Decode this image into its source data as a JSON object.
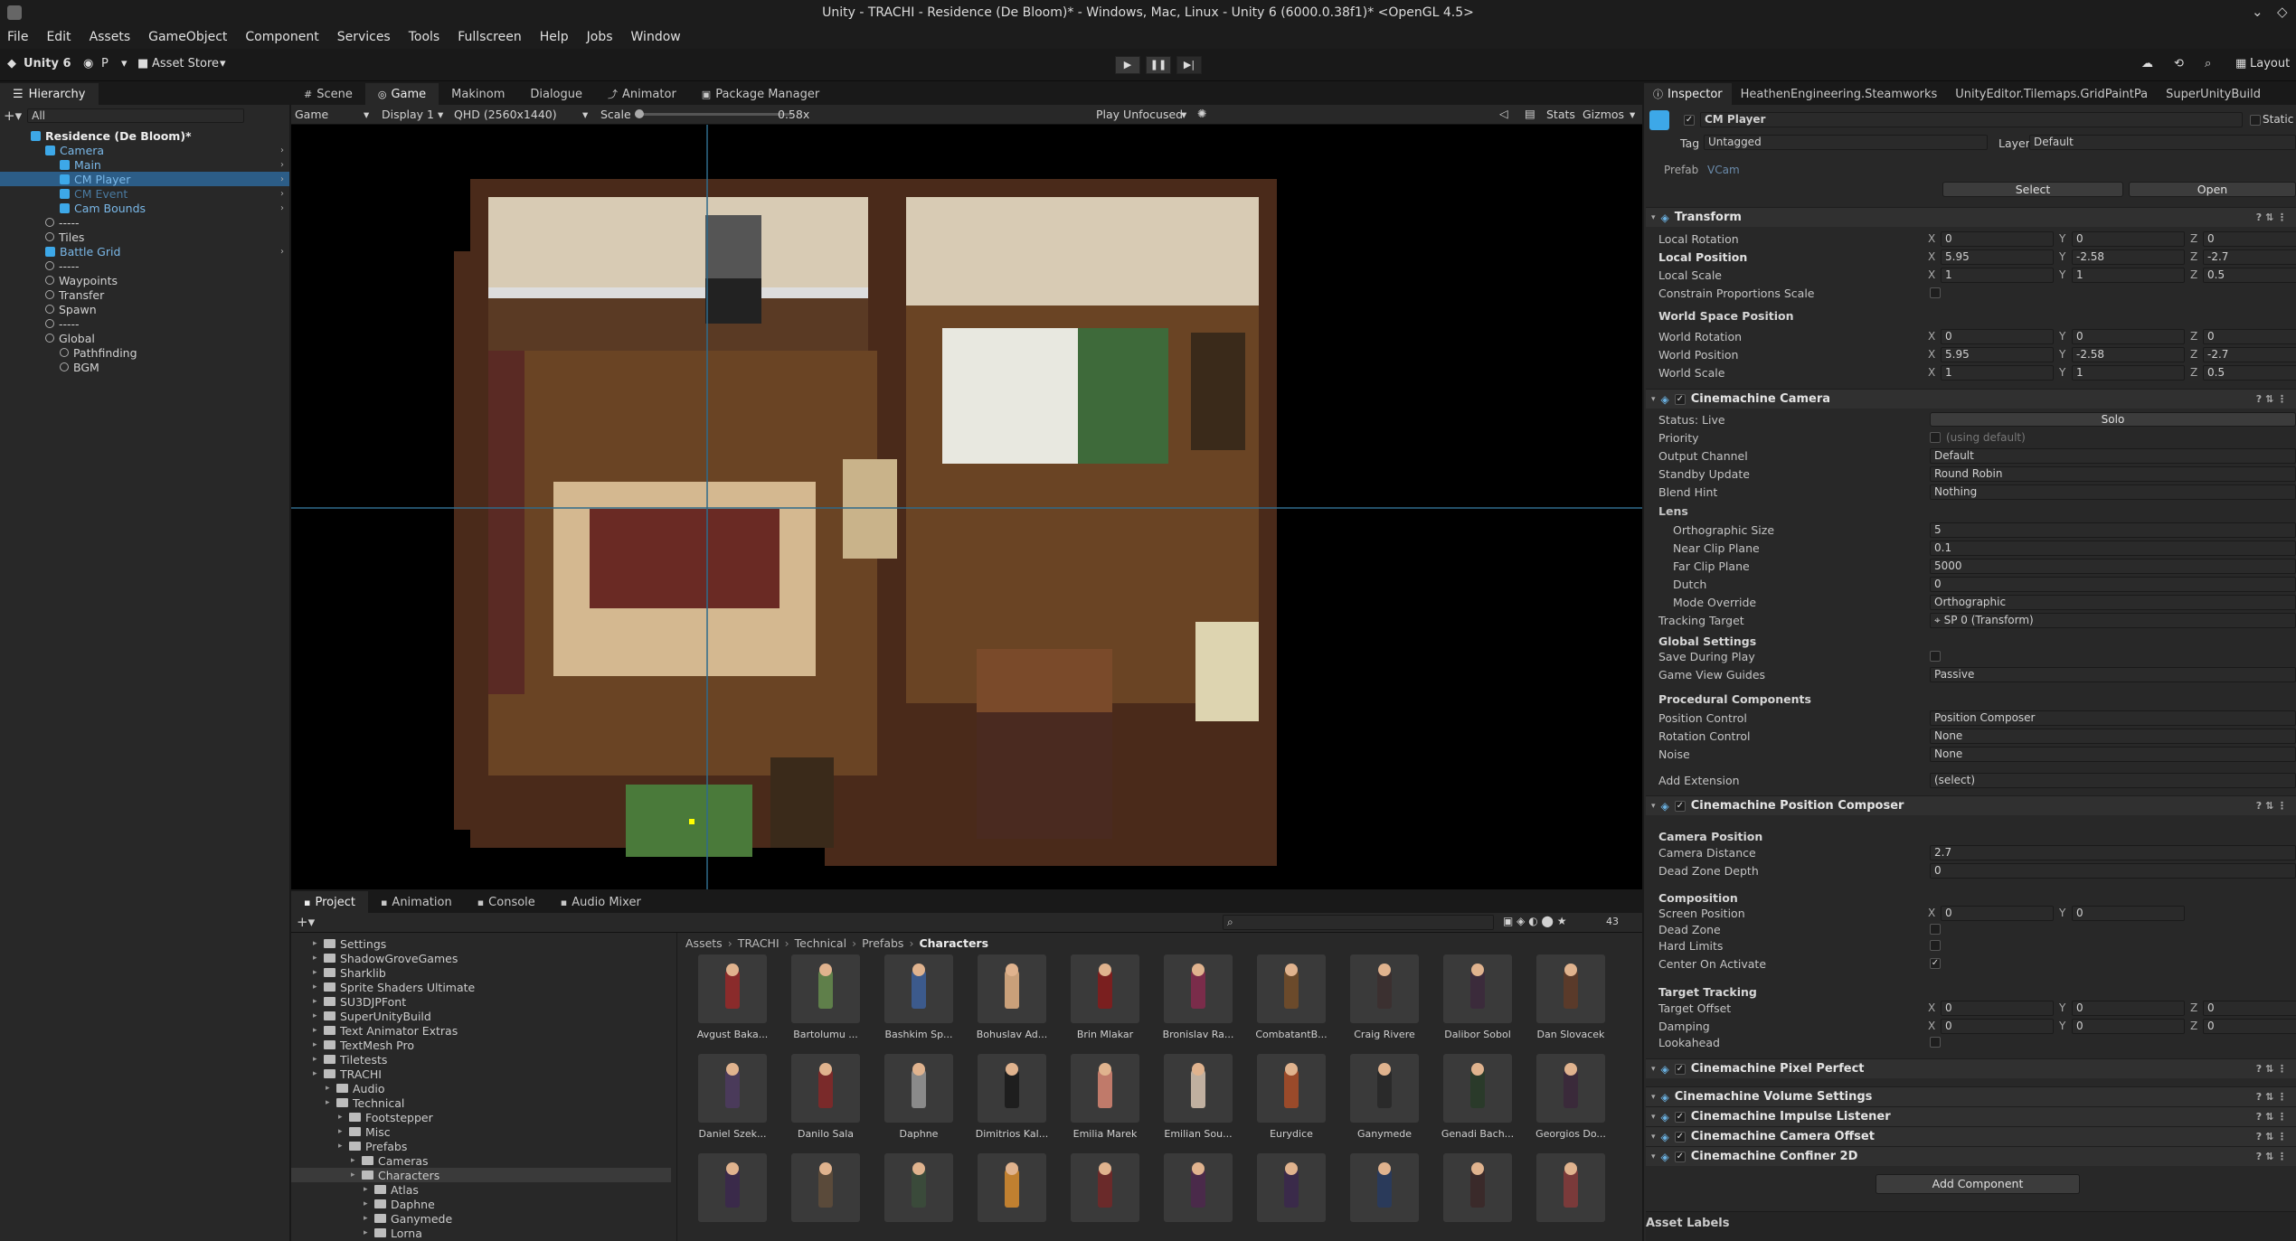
{
  "window": {
    "title": "Unity - TRACHI - Residence (De Bloom)* - Windows, Mac, Linux - Unity 6 (6000.0.38f1)* <OpenGL 4.5>"
  },
  "menu": [
    "File",
    "Edit",
    "Assets",
    "GameObject",
    "Component",
    "Services",
    "Tools",
    "Fullscreen",
    "Help",
    "Jobs",
    "Window"
  ],
  "toolbar": {
    "account": "Unity 6",
    "user": "P",
    "asset_store": "Asset Store",
    "layout": "Layout"
  },
  "hierarchy": {
    "tab": "Hierarchy",
    "search_placeholder": "All",
    "items": [
      {
        "label": "Residence (De Bloom)*",
        "depth": 0,
        "kind": "scene"
      },
      {
        "label": "Camera",
        "depth": 1,
        "kind": "blue"
      },
      {
        "label": "Main",
        "depth": 2,
        "kind": "blue"
      },
      {
        "label": "CM Player",
        "depth": 2,
        "kind": "blue",
        "selected": true
      },
      {
        "label": "CM Event",
        "depth": 2,
        "kind": "blue",
        "dim": true
      },
      {
        "label": "Cam Bounds",
        "depth": 2,
        "kind": "blue"
      },
      {
        "label": "-----",
        "depth": 1,
        "kind": "gray"
      },
      {
        "label": "Tiles",
        "depth": 1,
        "kind": "gray"
      },
      {
        "label": "Battle Grid",
        "depth": 1,
        "kind": "blue"
      },
      {
        "label": "-----",
        "depth": 1,
        "kind": "gray"
      },
      {
        "label": "Waypoints",
        "depth": 1,
        "kind": "gray"
      },
      {
        "label": "Transfer",
        "depth": 1,
        "kind": "gray"
      },
      {
        "label": "Spawn",
        "depth": 1,
        "kind": "gray"
      },
      {
        "label": "-----",
        "depth": 1,
        "kind": "gray"
      },
      {
        "label": "Global",
        "depth": 1,
        "kind": "gray"
      },
      {
        "label": "Pathfinding",
        "depth": 2,
        "kind": "gray"
      },
      {
        "label": "BGM",
        "depth": 2,
        "kind": "gray"
      }
    ]
  },
  "center_tabs": [
    "Scene",
    "Game",
    "Makinom",
    "Dialogue",
    "Animator",
    "Package Manager"
  ],
  "game_bar": {
    "mode": "Game",
    "display": "Display 1",
    "resolution": "QHD (2560x1440)",
    "scale_label": "Scale",
    "scale_value": "0.58x",
    "play_mode": "Play Unfocused",
    "stats": "Stats",
    "gizmos": "Gizmos"
  },
  "bottom_tabs": [
    "Project",
    "Animation",
    "Console",
    "Audio Mixer"
  ],
  "project": {
    "count_badge": "43",
    "breadcrumb": [
      "Assets",
      "TRACHI",
      "Technical",
      "Prefabs",
      "Characters"
    ],
    "tree": [
      {
        "label": "Settings",
        "depth": 1
      },
      {
        "label": "ShadowGroveGames",
        "depth": 1
      },
      {
        "label": "Sharklib",
        "depth": 1
      },
      {
        "label": "Sprite Shaders Ultimate",
        "depth": 1
      },
      {
        "label": "SU3DJPFont",
        "depth": 1
      },
      {
        "label": "SuperUnityBuild",
        "depth": 1
      },
      {
        "label": "Text Animator Extras",
        "depth": 1
      },
      {
        "label": "TextMesh Pro",
        "depth": 1
      },
      {
        "label": "Tiletests",
        "depth": 1
      },
      {
        "label": "TRACHI",
        "depth": 1
      },
      {
        "label": "Audio",
        "depth": 2
      },
      {
        "label": "Technical",
        "depth": 2
      },
      {
        "label": "Footstepper",
        "depth": 3
      },
      {
        "label": "Misc",
        "depth": 3
      },
      {
        "label": "Prefabs",
        "depth": 3
      },
      {
        "label": "Cameras",
        "depth": 4
      },
      {
        "label": "Characters",
        "depth": 4,
        "selected": true
      },
      {
        "label": "Atlas",
        "depth": 5
      },
      {
        "label": "Daphne",
        "depth": 5
      },
      {
        "label": "Ganymede",
        "depth": 5
      },
      {
        "label": "Lorna",
        "depth": 5
      }
    ],
    "assets": [
      {
        "label": "Avgust Baka...",
        "color": "#8a2b2b"
      },
      {
        "label": "Bartolumu ...",
        "color": "#5f7f4a"
      },
      {
        "label": "Bashkim Sp...",
        "color": "#3c5a8c"
      },
      {
        "label": "Bohuslav Ad...",
        "color": "#c9a07a"
      },
      {
        "label": "Brin Mlakar",
        "color": "#7a1f1f"
      },
      {
        "label": "Bronislav Ra...",
        "color": "#7a2c4a"
      },
      {
        "label": "CombatantB...",
        "color": "#6b4a2b"
      },
      {
        "label": "Craig Rivere",
        "color": "#3b3030"
      },
      {
        "label": "Dalibor Sobol",
        "color": "#3b2b3b"
      },
      {
        "label": "Dan Slovacek",
        "color": "#5a3a2a"
      },
      {
        "label": "Daniel Szek...",
        "color": "#4a3a5a"
      },
      {
        "label": "Danilo Sala",
        "color": "#7a2a2a"
      },
      {
        "label": "Daphne",
        "color": "#8a8a8a"
      },
      {
        "label": "Dimitrios Kal...",
        "color": "#1e1e1e"
      },
      {
        "label": "Emilia Marek",
        "color": "#c07a6a"
      },
      {
        "label": "Emilian Sou...",
        "color": "#c0b0a0"
      },
      {
        "label": "Eurydice",
        "color": "#9a4a2a"
      },
      {
        "label": "Ganymede",
        "color": "#2a2a2a"
      },
      {
        "label": "Genadi Bach...",
        "color": "#2a3a2a"
      },
      {
        "label": "Georgios Do...",
        "color": "#3a2a3a"
      },
      {
        "label": "",
        "color": "#3a2a4a"
      },
      {
        "label": "",
        "color": "#5a4a3a"
      },
      {
        "label": "",
        "color": "#3a4a3a"
      },
      {
        "label": "",
        "color": "#c08030"
      },
      {
        "label": "",
        "color": "#6a2a2a"
      },
      {
        "label": "",
        "color": "#4a2a4a"
      },
      {
        "label": "",
        "color": "#3a2a4a"
      },
      {
        "label": "",
        "color": "#2a3a5a"
      },
      {
        "label": "",
        "color": "#3a2a2a"
      },
      {
        "label": "",
        "color": "#7a3a3a"
      }
    ]
  },
  "inspector_tabs": [
    "Inspector",
    "HeathenEngineering.Steamworks",
    "UnityEditor.Tilemaps.GridPaintPa",
    "SuperUnityBuild"
  ],
  "inspector": {
    "object_name": "CM Player",
    "static_label": "Static",
    "tag_label": "Tag",
    "tag_value": "Untagged",
    "layer_label": "Layer",
    "layer_value": "Default",
    "prefab_label": "Prefab",
    "prefab_value": "VCam",
    "select_button": "Select",
    "open_button": "Open",
    "transform": {
      "title": "Transform",
      "rows": [
        {
          "label": "Local Rotation",
          "x": "0",
          "y": "0",
          "z": "0"
        },
        {
          "label": "Local Position",
          "x": "5.95",
          "y": "-2.58",
          "z": "-2.7",
          "bold": true
        },
        {
          "label": "Local Scale",
          "x": "1",
          "y": "1",
          "z": "0.5"
        }
      ],
      "constrain_label": "Constrain Proportions Scale",
      "world_title": "World Space Position",
      "world_rows": [
        {
          "label": "World Rotation",
          "x": "0",
          "y": "0",
          "z": "0"
        },
        {
          "label": "World Position",
          "x": "5.95",
          "y": "-2.58",
          "z": "-2.7"
        },
        {
          "label": "World Scale",
          "x": "1",
          "y": "1",
          "z": "0.5"
        }
      ]
    },
    "cm_camera": {
      "title": "Cinemachine Camera",
      "status_label": "Status: Live",
      "solo": "Solo",
      "rows": [
        {
          "label": "Priority",
          "value": "(using default)"
        },
        {
          "label": "Output Channel",
          "value": "Default"
        },
        {
          "label": "Standby Update",
          "value": "Round Robin"
        },
        {
          "label": "Blend Hint",
          "value": "Nothing"
        }
      ],
      "lens_label": "Lens",
      "lens_rows": [
        {
          "label": "Orthographic Size",
          "value": "5"
        },
        {
          "label": "Near Clip Plane",
          "value": "0.1"
        },
        {
          "label": "Far Clip Plane",
          "value": "5000"
        },
        {
          "label": "Dutch",
          "value": "0"
        },
        {
          "label": "Mode Override",
          "value": "Orthographic"
        }
      ],
      "tracking_label": "Tracking Target",
      "tracking_value": "SP 0 (Transform)",
      "global_title": "Global Settings",
      "save_label": "Save During Play",
      "guides_label": "Game View Guides",
      "guides_value": "Passive",
      "proc_title": "Procedural Components",
      "proc_rows": [
        {
          "label": "Position Control",
          "value": "Position Composer"
        },
        {
          "label": "Rotation Control",
          "value": "None"
        },
        {
          "label": "Noise",
          "value": "None"
        }
      ],
      "ext_label": "Add Extension",
      "ext_value": "(select)"
    },
    "composer": {
      "title": "Cinemachine Position Composer",
      "campos_title": "Camera Position",
      "distance_label": "Camera Distance",
      "distance_value": "2.7",
      "deadzone_depth_label": "Dead Zone Depth",
      "deadzone_depth_value": "0",
      "composition_title": "Composition",
      "screen_label": "Screen Position",
      "screen_x": "0",
      "screen_y": "0",
      "deadzone_label": "Dead Zone",
      "hardlimits_label": "Hard Limits",
      "center_label": "Center On Activate",
      "tracking_title": "Target Tracking",
      "offset_label": "Target Offset",
      "offset": {
        "x": "0",
        "y": "0",
        "z": "0"
      },
      "damping_label": "Damping",
      "damping": {
        "x": "0",
        "y": "0",
        "z": "0"
      },
      "lookahead_label": "Lookahead"
    },
    "components": [
      "Cinemachine Pixel Perfect",
      "Cinemachine Volume Settings",
      "Cinemachine Impulse Listener",
      "Cinemachine Camera Offset",
      "Cinemachine Confiner 2D"
    ],
    "add_component": "Add Component",
    "asset_labels": "Asset Labels"
  }
}
